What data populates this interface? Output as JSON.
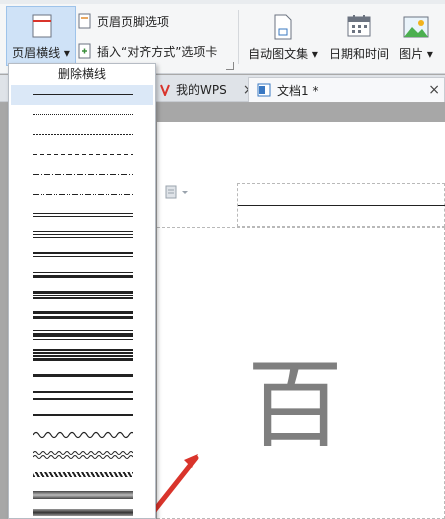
{
  "ribbon": {
    "header_line_label": "页眉横线",
    "header_footer_options_label": "页眉页脚选项",
    "insert_alignment_tab_label": "插入“对齐方式”选项卡",
    "auto_text_label": "自动图文集",
    "date_time_label": "日期和时间",
    "picture_label": "图片"
  },
  "tabs": [
    {
      "label": "我的WPS",
      "close": "×"
    },
    {
      "label": "文档1 *",
      "close": "×"
    }
  ],
  "dropdown": {
    "delete_label": "删除横线",
    "options": [
      {
        "style": "solid-thin"
      },
      {
        "style": "dotted"
      },
      {
        "style": "dotted-dense"
      },
      {
        "style": "dashed"
      },
      {
        "style": "dash-dot"
      },
      {
        "style": "dash-dot-dot"
      },
      {
        "style": "double-thin"
      },
      {
        "style": "triple-thin"
      },
      {
        "style": "thick-thin"
      },
      {
        "style": "thin-thick"
      },
      {
        "style": "thick-thin-thick"
      },
      {
        "style": "double-thick"
      },
      {
        "style": "thin-thick-thin"
      },
      {
        "style": "multi-band"
      },
      {
        "style": "single-thick"
      },
      {
        "style": "double-spaced"
      },
      {
        "style": "wave"
      },
      {
        "style": "double-wave"
      },
      {
        "style": "hatched"
      },
      {
        "style": "gradient-band"
      },
      {
        "style": "gradient-band-2"
      }
    ]
  },
  "document": {
    "body_char": "百"
  },
  "colors": {
    "accent": "#9ec3ea",
    "arrow": "#d9342b",
    "char": "#7f7f7f"
  }
}
